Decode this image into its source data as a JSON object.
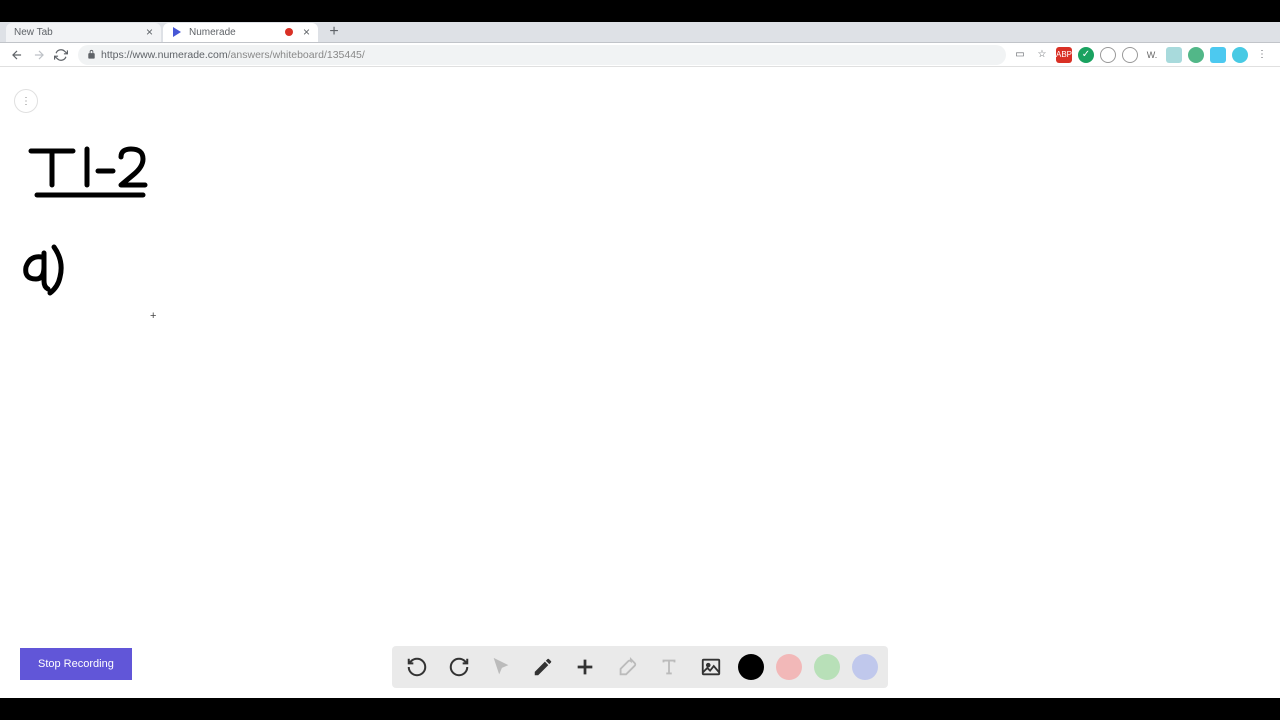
{
  "tabs": [
    {
      "title": "New Tab"
    },
    {
      "title": "Numerade"
    }
  ],
  "url": {
    "host": "https://www.numerade.com",
    "path": "/answers/whiteboard/135445/"
  },
  "menu_bubble": "⋮",
  "stop_recording_label": "Stop Recording",
  "colors": {
    "black": "#000000",
    "red": "#f2b8b8",
    "green": "#b8e0b8",
    "blue": "#c0c8ec"
  }
}
